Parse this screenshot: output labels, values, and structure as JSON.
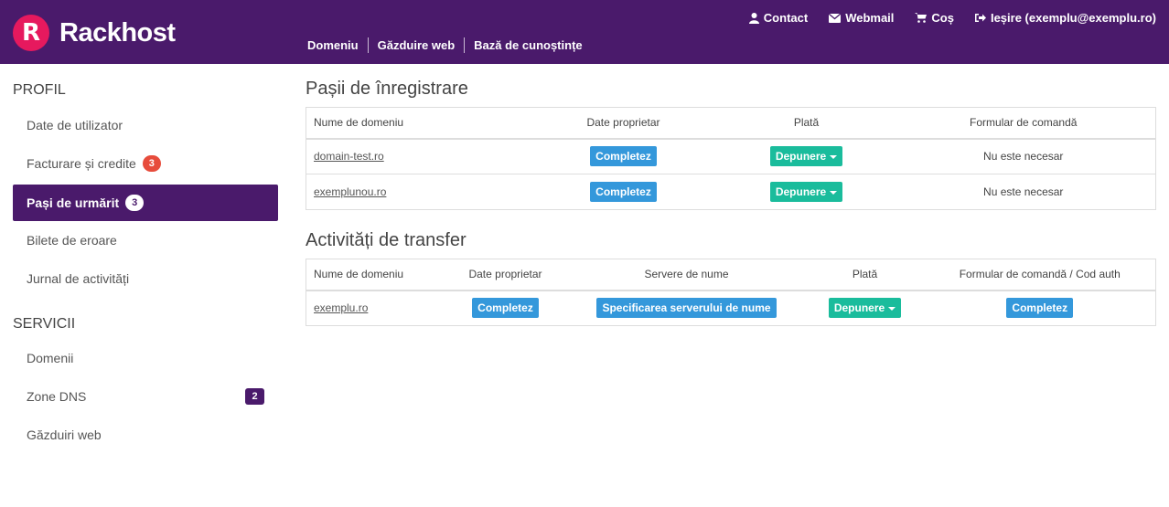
{
  "brand": {
    "logo_letter": "R",
    "name": "Rackhost",
    "accent": "#4a1a6b",
    "logo_color": "#e6195e"
  },
  "topnav": {
    "contact": {
      "label": "Contact",
      "icon": "user-icon"
    },
    "webmail": {
      "label": "Webmail",
      "icon": "envelope-icon"
    },
    "cart": {
      "label": "Coș",
      "icon": "cart-icon"
    },
    "logout": {
      "label": "Ieșire (exemplu@exemplu.ro)",
      "icon": "sign-out-icon"
    }
  },
  "mainnav": [
    "Domeniu",
    "Găzduire web",
    "Bază de cunoștințe"
  ],
  "sidebar": {
    "profile_heading": "PROFIL",
    "profile_items": [
      {
        "label": "Date de utilizator"
      },
      {
        "label": "Facturare și credite",
        "badge": "3"
      },
      {
        "label": "Pași de urmărit",
        "badge": "3",
        "active": true
      },
      {
        "label": "Bilete de eroare"
      },
      {
        "label": "Jurnal de activități"
      }
    ],
    "services_heading": "SERVICII",
    "services_items": [
      {
        "label": "Domenii"
      },
      {
        "label": "Zone DNS",
        "badge": "2"
      },
      {
        "label": "Găzduiri web"
      }
    ]
  },
  "registration": {
    "title": "Pașii de înregistrare",
    "headers": [
      "Nume de domeniu",
      "Date proprietar",
      "Plată",
      "Formular de comandă"
    ],
    "rows": [
      {
        "domain": "domain-test.ro",
        "owner_btn": "Completez",
        "pay_btn": "Depunere",
        "order": "Nu este necesar"
      },
      {
        "domain": "exemplunou.ro",
        "owner_btn": "Completez",
        "pay_btn": "Depunere",
        "order": "Nu este necesar"
      }
    ]
  },
  "transfer": {
    "title": "Activități de transfer",
    "headers": [
      "Nume de domeniu",
      "Date proprietar",
      "Servere de nume",
      "Plată",
      "Formular de comandă / Cod auth"
    ],
    "rows": [
      {
        "domain": "exemplu.ro",
        "owner_btn": "Completez",
        "ns_btn": "Specificarea serverului de nume",
        "pay_btn": "Depunere",
        "auth_btn": "Completez"
      }
    ]
  }
}
